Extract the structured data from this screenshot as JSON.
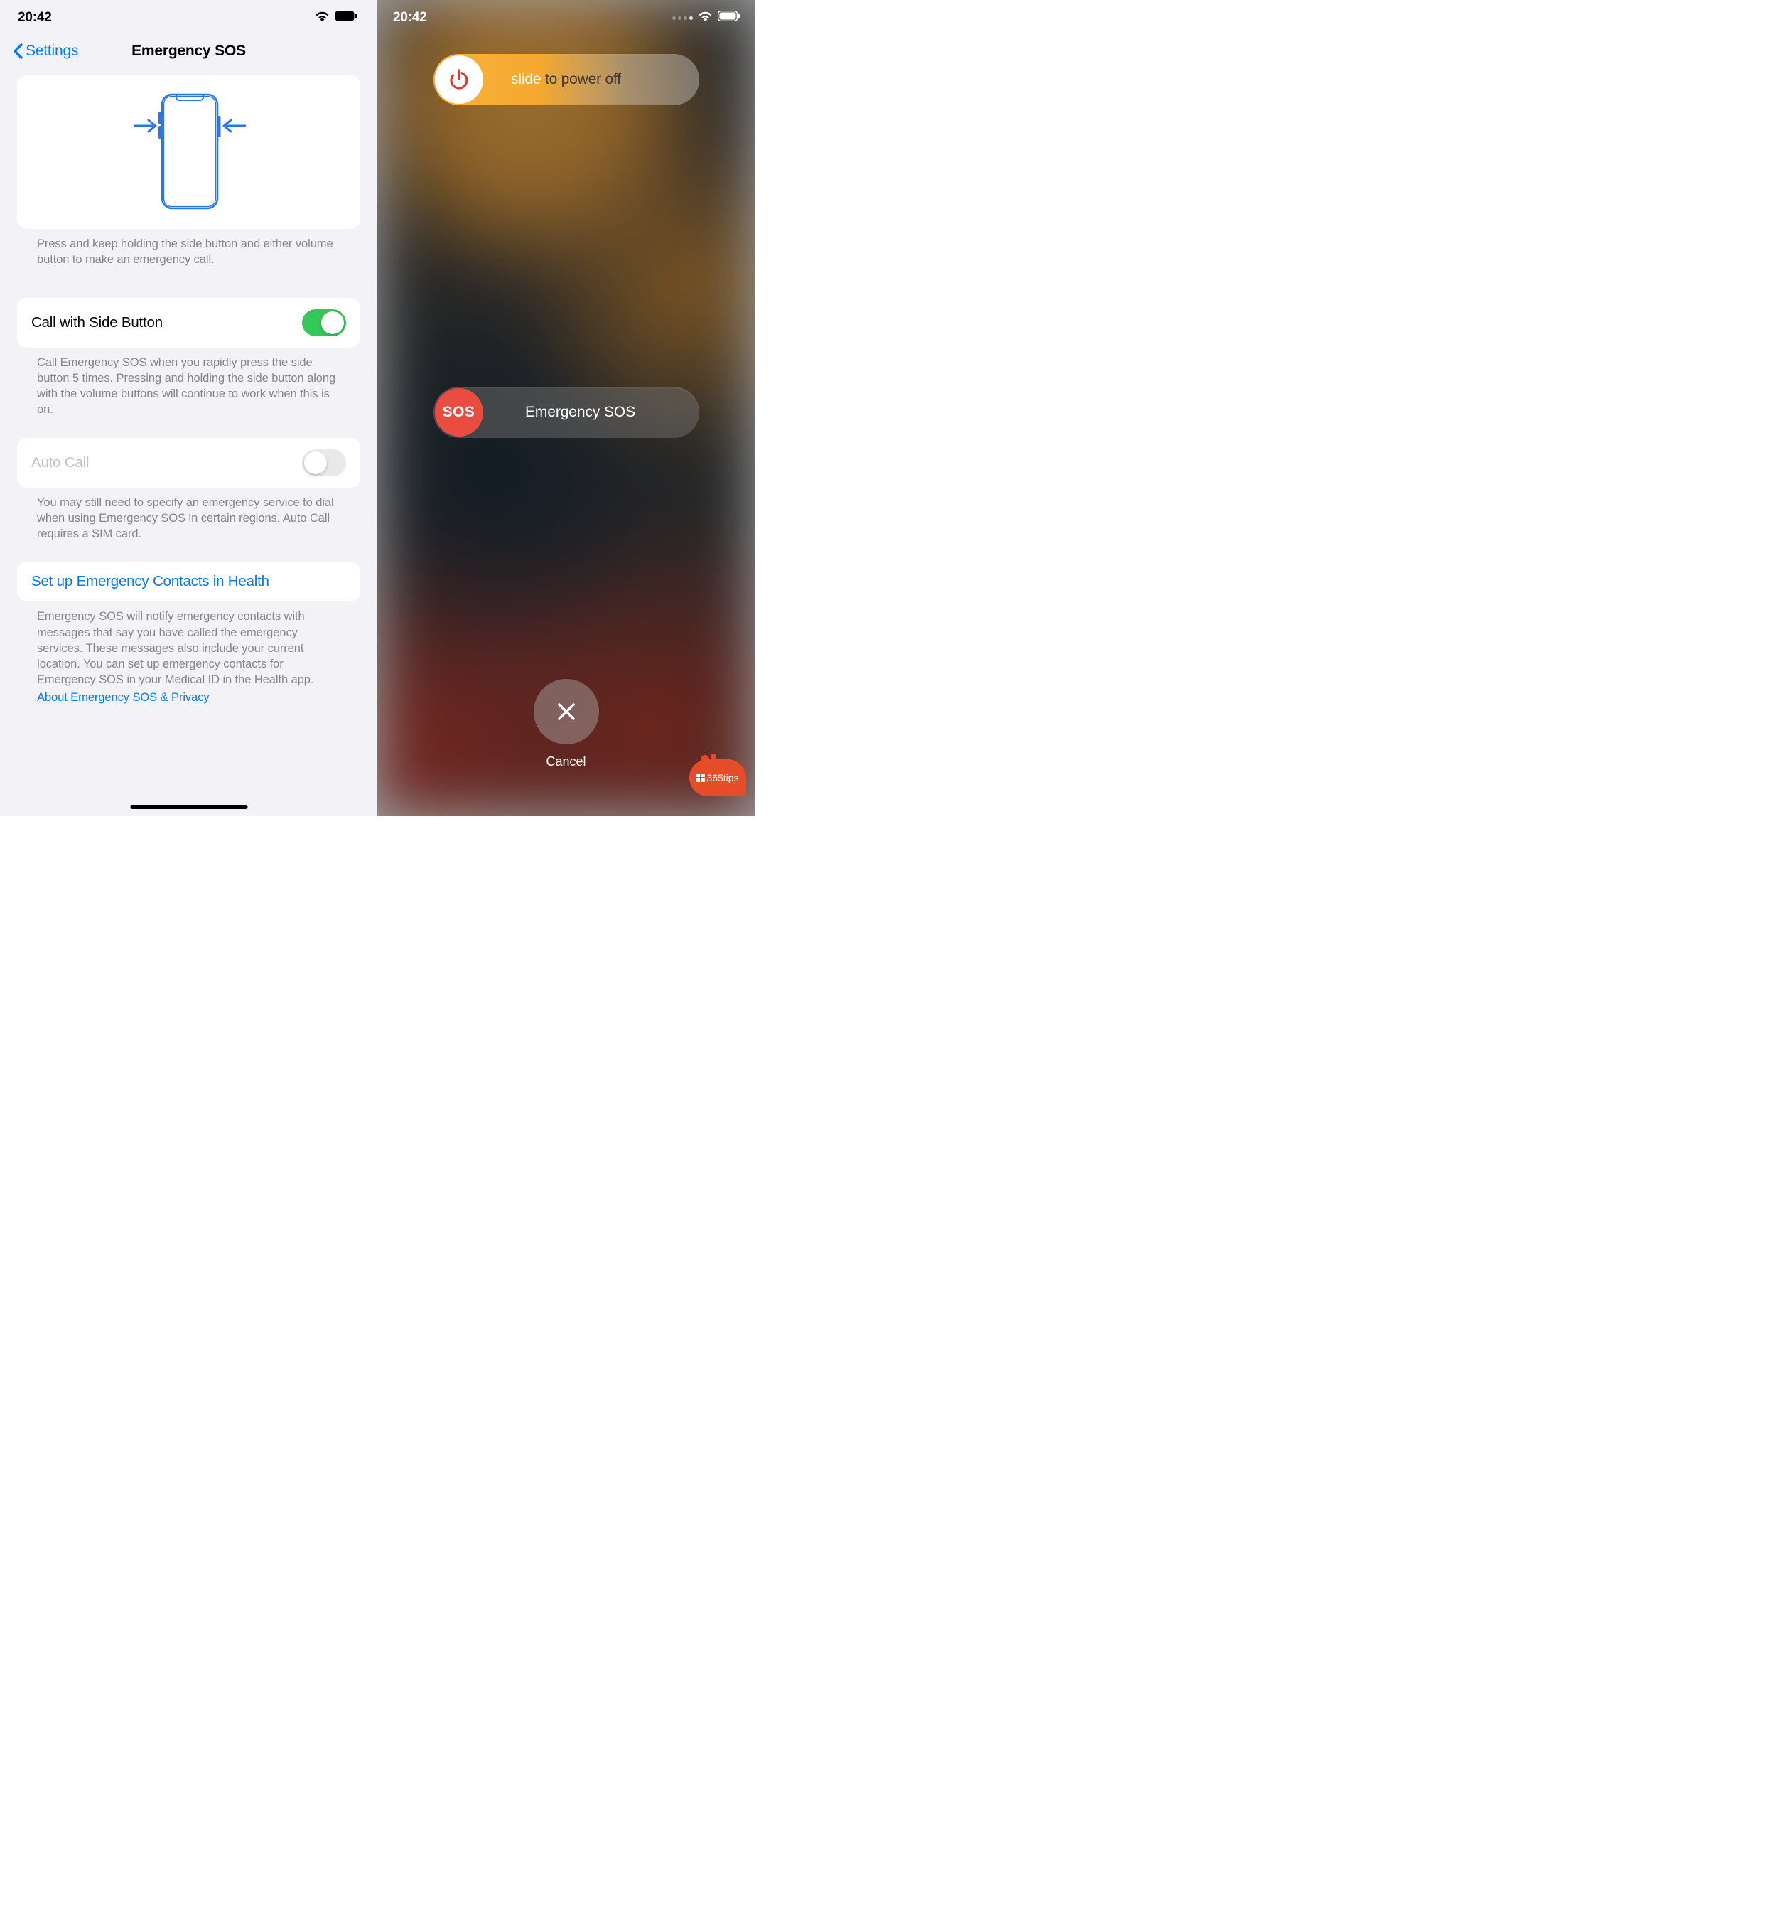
{
  "status": {
    "time": "20:42"
  },
  "settings": {
    "nav": {
      "back_label": "Settings",
      "title": "Emergency SOS"
    },
    "diagram_caption": "Press and keep holding the side button and either volume button to make an emergency call.",
    "call_side": {
      "label": "Call with Side Button",
      "caption": "Call Emergency SOS when you rapidly press the side button 5 times. Pressing and holding the side button along with the volume buttons will continue to work when this is on.",
      "enabled": true
    },
    "auto_call": {
      "label": "Auto Call",
      "caption": "You may still need to specify an emergency service to dial when using Emergency SOS in certain regions. Auto Call requires a SIM card.",
      "enabled": false
    },
    "setup_link": "Set up Emergency Contacts in Health",
    "contacts_caption": "Emergency SOS will notify emergency contacts with messages that say you have called the emergency services. These messages also include your current location. You can set up emergency contacts for Emergency SOS in your Medical ID in the Health app.",
    "privacy_link": "About Emergency SOS & Privacy"
  },
  "power": {
    "slide_text_a": "slide ",
    "slide_text_b": "to power off",
    "sos_knob": "SOS",
    "sos_label": "Emergency SOS",
    "cancel": "Cancel"
  },
  "watermark": "365tips"
}
